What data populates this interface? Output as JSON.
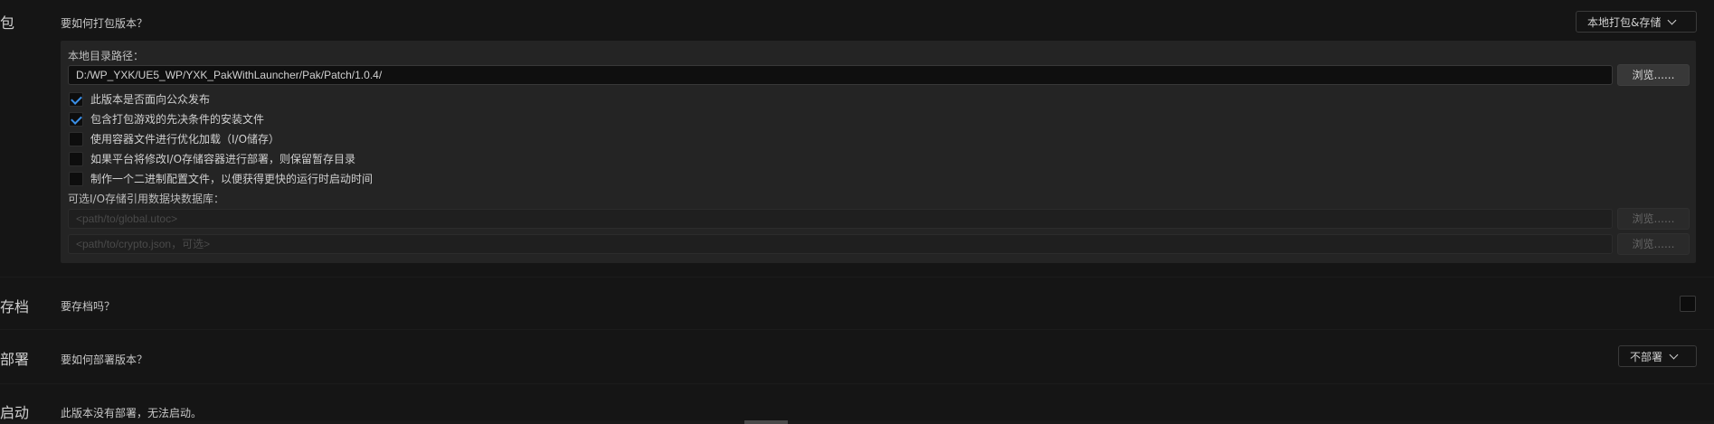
{
  "package": {
    "section_label": "包",
    "question": "要如何打包版本？",
    "mode_value": "本地打包&存储",
    "local_dir_label": "本地目录路径：",
    "local_dir_value": "D:/WP_YXK/UE5_WP/YXK_PakWithLauncher/Pak/Patch/1.0.4/",
    "browse_label": "浏览......",
    "checkboxes": [
      {
        "label": "此版本是否面向公众发布",
        "checked": true
      },
      {
        "label": "包含打包游戏的先决条件的安装文件",
        "checked": true
      },
      {
        "label": "使用容器文件进行优化加载（I/O储存）",
        "checked": false
      },
      {
        "label": "如果平台将修改I/O存储容器进行部署，则保留暂存目录",
        "checked": false
      },
      {
        "label": "制作一个二进制配置文件，以便获得更快的运行时启动时间",
        "checked": false
      }
    ],
    "io_ref_label": "可选I/O存储引用数据块数据库：",
    "io_ref_placeholder": "<path/to/global.utoc>",
    "crypto_placeholder": "<path/to/crypto.json，可选>",
    "browse_disabled_label": "浏览......"
  },
  "archive": {
    "section_label": "存档",
    "question": "要存档吗？",
    "checked": false
  },
  "deploy": {
    "section_label": "部署",
    "question": "要如何部署版本？",
    "mode_value": "不部署"
  },
  "launch": {
    "section_label": "启动",
    "message": "此版本没有部署，无法启动。"
  }
}
